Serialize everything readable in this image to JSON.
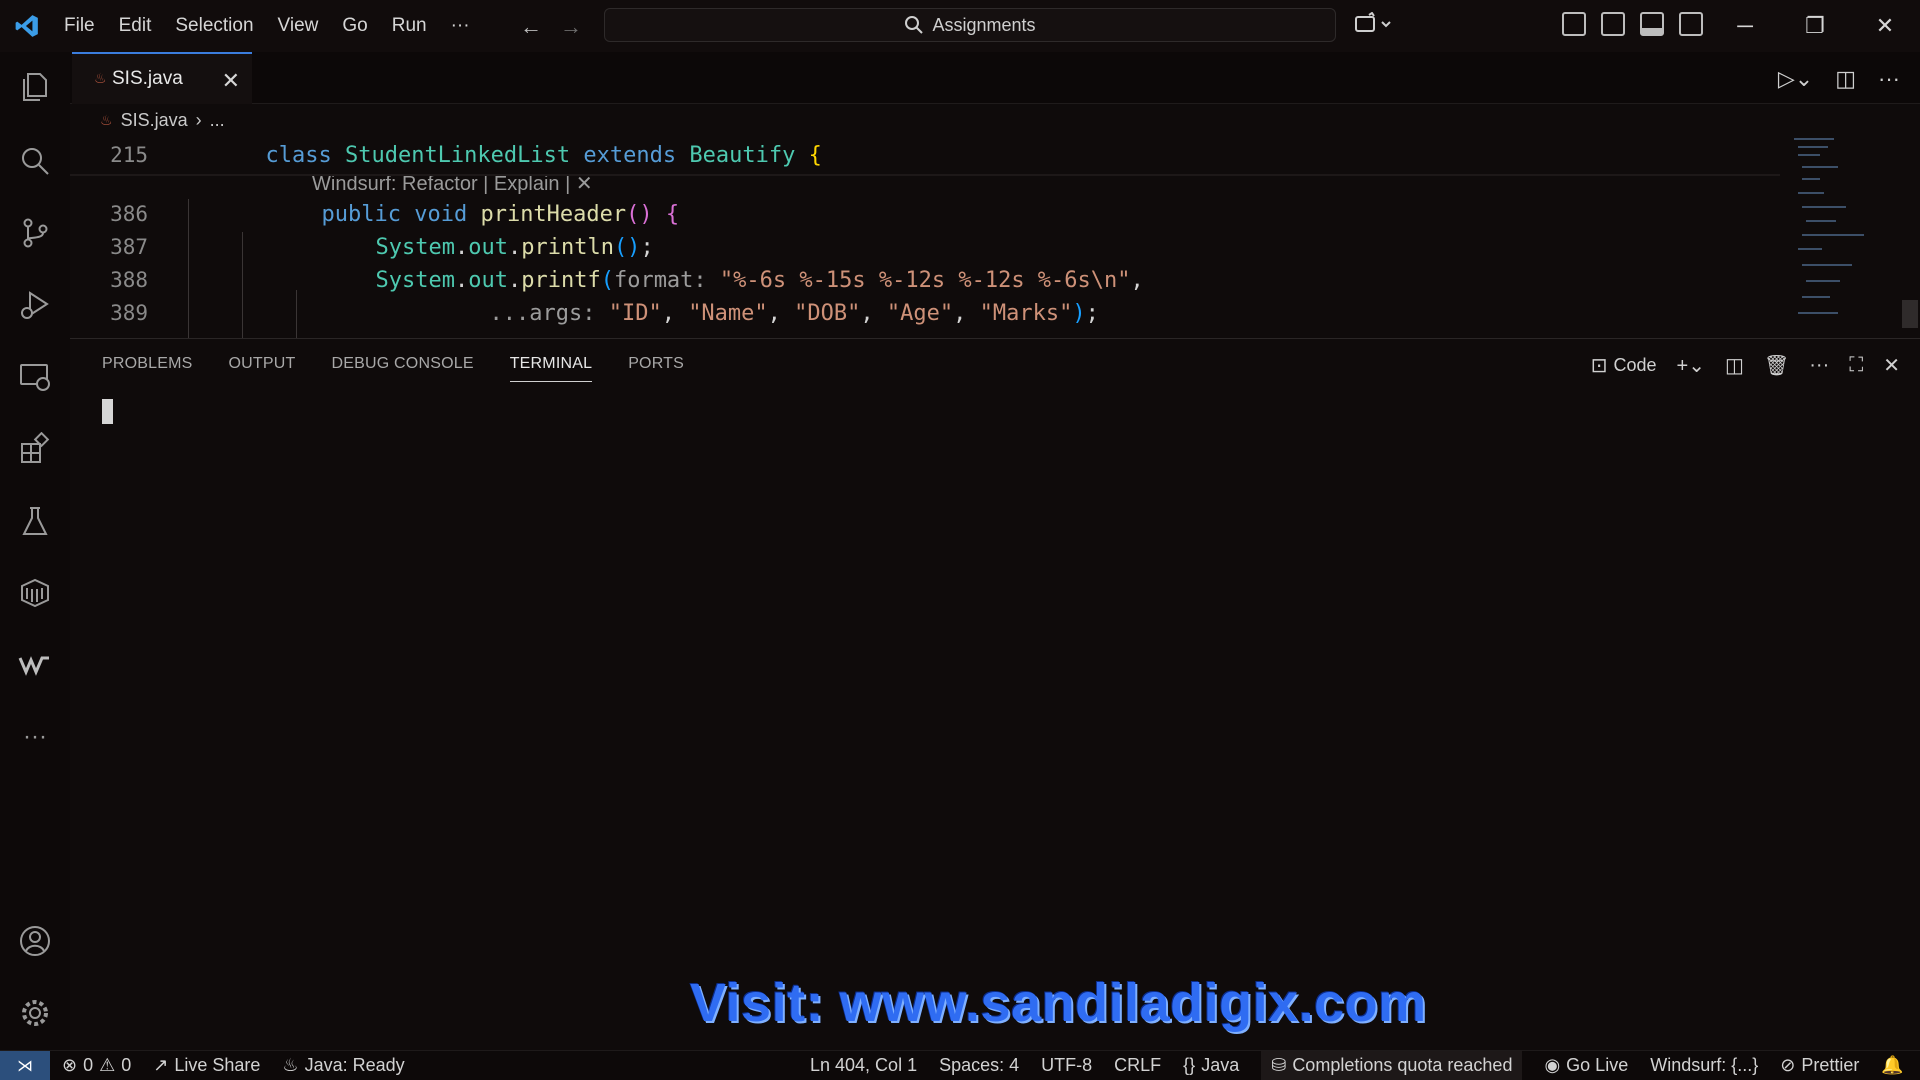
{
  "titlebar": {
    "menu": [
      "File",
      "Edit",
      "Selection",
      "View",
      "Go",
      "Run",
      "···"
    ],
    "search_label": "Assignments"
  },
  "editor": {
    "tab_name": "SIS.java",
    "breadcrumb_file": "SIS.java",
    "breadcrumb_rest": "...",
    "codelens": "Windsurf: Refactor | Explain | ✕",
    "lines": [
      {
        "num": "215",
        "tokens": [
          "class",
          "StudentLinkedList",
          "extends",
          "Beautify",
          "{"
        ]
      },
      {
        "num": "386",
        "tokens": [
          "public",
          "void",
          "printHeader",
          "()",
          "{"
        ]
      },
      {
        "num": "387",
        "tokens": [
          "System",
          ".",
          "out",
          ".",
          "println",
          "()",
          ";"
        ]
      },
      {
        "num": "388",
        "tokens": [
          "System",
          ".",
          "out",
          ".",
          "printf",
          "(",
          "format:",
          "\"%-6s %-15s %-12s %-12s %-6s\\n\"",
          ","
        ]
      },
      {
        "num": "389",
        "tokens": [
          "...args:",
          "\"ID\"",
          ",",
          "\"Name\"",
          ",",
          "\"DOB\"",
          ",",
          "\"Age\"",
          ",",
          "\"Marks\"",
          ")",
          ";"
        ]
      }
    ]
  },
  "panel": {
    "tabs": [
      "PROBLEMS",
      "OUTPUT",
      "DEBUG CONSOLE",
      "TERMINAL",
      "PORTS"
    ],
    "active_tab": "TERMINAL",
    "terminal_profile": "Code"
  },
  "watermark": "Visit: www.sandiladigix.com",
  "statusbar": {
    "errors": "0",
    "warnings": "0",
    "live_share": "Live Share",
    "java_status": "Java: Ready",
    "cursor_pos": "Ln 404, Col 1",
    "spaces": "Spaces: 4",
    "encoding": "UTF-8",
    "eol": "CRLF",
    "language": "Java",
    "completions": "Completions quota reached",
    "go_live": "Go Live",
    "windsurf": "Windsurf: {...}",
    "prettier": "Prettier"
  },
  "colors": {
    "accent": "#3b7ddd",
    "keyword": "#569cd6",
    "type": "#4ec9b0",
    "function": "#dcdcaa",
    "string": "#ce9178",
    "watermark": "#2f6cf2"
  }
}
